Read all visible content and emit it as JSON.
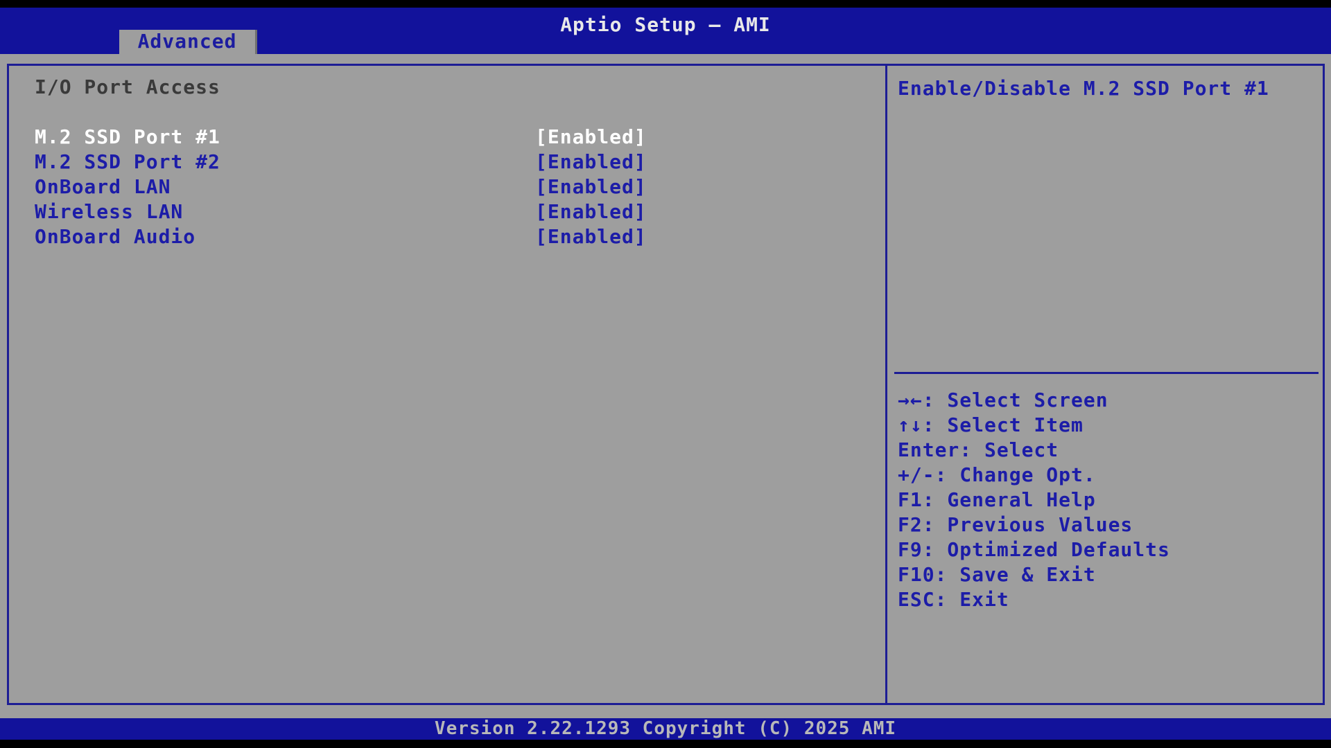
{
  "title_bar": {
    "title": "Aptio Setup – AMI"
  },
  "tabs": [
    {
      "label": "Advanced",
      "active": true
    }
  ],
  "main": {
    "section_title": "I/O Port Access",
    "items": [
      {
        "label": "M.2 SSD Port #1",
        "value": "[Enabled]",
        "selected": true
      },
      {
        "label": "M.2 SSD Port #2",
        "value": "[Enabled]",
        "selected": false
      },
      {
        "label": "OnBoard LAN",
        "value": "[Enabled]",
        "selected": false
      },
      {
        "label": "Wireless LAN",
        "value": "[Enabled]",
        "selected": false
      },
      {
        "label": "OnBoard Audio",
        "value": "[Enabled]",
        "selected": false
      }
    ]
  },
  "help_panel": {
    "description": "Enable/Disable M.2 SSD Port #1",
    "hints": [
      "→←: Select Screen",
      "↑↓: Select Item",
      "Enter: Select",
      "+/-: Change Opt.",
      "F1: General Help",
      "F2: Previous Values",
      "F9: Optimized Defaults",
      "F10: Save & Exit",
      "ESC: Exit"
    ]
  },
  "status_bar": {
    "version_text": "Version 2.22.1293 Copyright (C) 2025 AMI"
  },
  "colors": {
    "header_blue": "#12129b",
    "border_navy": "#1d1d95",
    "background_gray": "#9e9e9e",
    "item_text_blue": "#1c1ca8",
    "selected_text_white": "#ffffff",
    "section_title_gray": "#3a3a3a",
    "title_text": "#e8e8e8",
    "version_text_gray": "#b8b8b8",
    "strip_black": "#000000"
  }
}
